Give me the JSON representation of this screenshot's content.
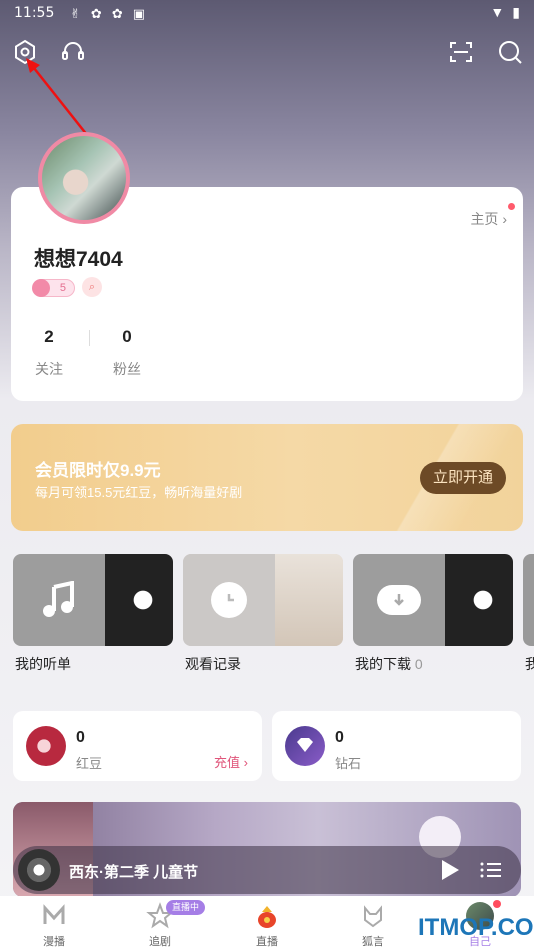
{
  "status_bar": {
    "time": "11:55",
    "left_icons": [
      "badge-icon",
      "gear-icon",
      "gear-icon",
      "notification-icon"
    ],
    "right_icons": [
      "wifi-icon",
      "battery-icon"
    ]
  },
  "profile": {
    "home_link": "主页 ›",
    "username": "想想7404",
    "level": "5",
    "stats": [
      {
        "value": "2",
        "label": "关注"
      },
      {
        "value": "0",
        "label": "粉丝"
      }
    ]
  },
  "vip": {
    "title": "会员限时仅9.9元",
    "subtitle": "每月可领15.5元红豆，畅听海量好剧",
    "button": "立即开通"
  },
  "tiles": [
    {
      "label": "我的听单",
      "count": "",
      "icon": "music-note-icon"
    },
    {
      "label": "观看记录",
      "count": "",
      "icon": "clock-icon"
    },
    {
      "label": "我的下载",
      "count": "0",
      "icon": "cloud-download-icon"
    },
    {
      "label": "我",
      "count": "",
      "icon": ""
    }
  ],
  "wallet": [
    {
      "value": "0",
      "label": "红豆",
      "action": "充值 ›",
      "icon": "red-bean-icon"
    },
    {
      "value": "0",
      "label": "钻石",
      "icon": "diamond-icon"
    }
  ],
  "player": {
    "title": "西东·第二季 儿童节"
  },
  "tabs": [
    {
      "label": "漫播",
      "icon": "m-logo-icon"
    },
    {
      "label": "追剧",
      "icon": "star-icon",
      "badge": "直播中"
    },
    {
      "label": "直播",
      "icon": "live-bag-icon"
    },
    {
      "label": "狐言",
      "icon": "fox-icon"
    },
    {
      "label": "自己",
      "icon": "avatar-icon"
    }
  ],
  "watermark": "ITMOP.COM",
  "colors": {
    "accent_pink": "#f08aa5",
    "vip_gold": "#f2cd8d",
    "vip_button": "#6d4a26",
    "recharge_text": "#e0557a",
    "live_badge": "#a57ee6"
  }
}
